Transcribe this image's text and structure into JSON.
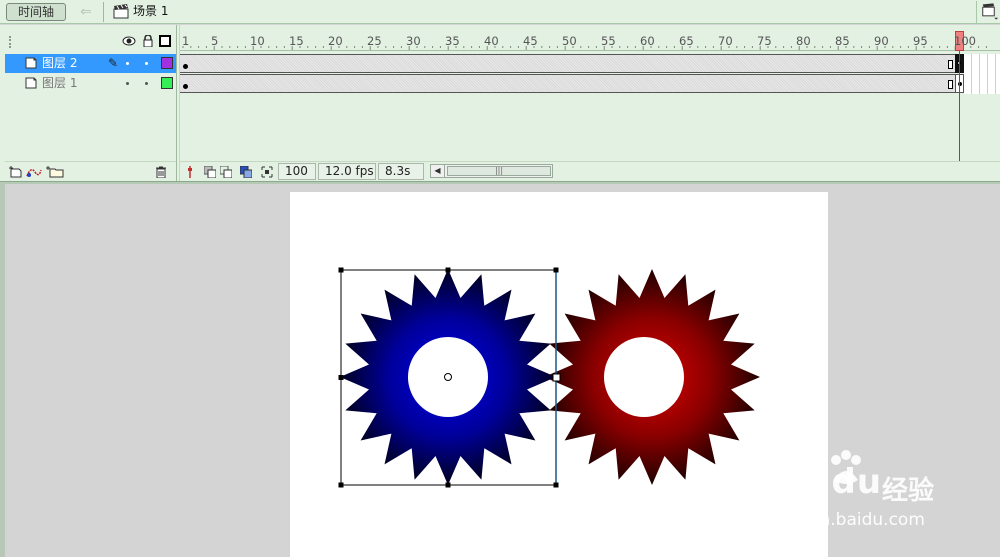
{
  "topbar": {
    "timeline_button": "时间轴",
    "back_icon": "left-arrow-icon",
    "scene_icon": "clapper-icon",
    "scene_label": "场景 1",
    "scene_menu_icon": "scene-menu-icon"
  },
  "layers": {
    "header_icons": [
      "eye-icon",
      "lock-icon",
      "outline-icon"
    ],
    "items": [
      {
        "name": "图层 2",
        "selected": true,
        "color": "#a030e0",
        "editing_icon": "pencil-icon"
      },
      {
        "name": "图层 1",
        "selected": false,
        "color": "#33ee55"
      }
    ],
    "footer_icons": [
      "insert-layer-icon",
      "add-motion-guide-icon",
      "insert-folder-icon",
      "delete-layer-icon"
    ]
  },
  "frames": {
    "tick_labels": [
      "1",
      "5",
      "10",
      "15",
      "20",
      "25",
      "30",
      "35",
      "40",
      "45",
      "50",
      "55",
      "60",
      "65",
      "70",
      "75",
      "80",
      "85",
      "90",
      "95",
      "100"
    ],
    "current_frame_marker": "100"
  },
  "status": {
    "icons": [
      "center-frame-icon",
      "onion-skin-icon",
      "onion-skin-outlines-icon",
      "edit-multiple-frames-icon",
      "modify-markers-icon"
    ],
    "current_frame": "100",
    "frame_rate": "12.0 fps",
    "elapsed_time": "8.3s"
  },
  "stage": {
    "gear_blue": {
      "center_color": "#0000ee",
      "edge_color": "#000020",
      "teeth": 20
    },
    "gear_red": {
      "center_color": "#dd0000",
      "edge_color": "#200000",
      "teeth": 20
    }
  },
  "watermark": {
    "brand": "Baidu",
    "suffix": "经验",
    "url": "jingyan.baidu.com"
  },
  "colors": {
    "panel_bg": "#e3f1e3",
    "selected_layer": "#3399ff",
    "playhead": "#ee8080"
  }
}
